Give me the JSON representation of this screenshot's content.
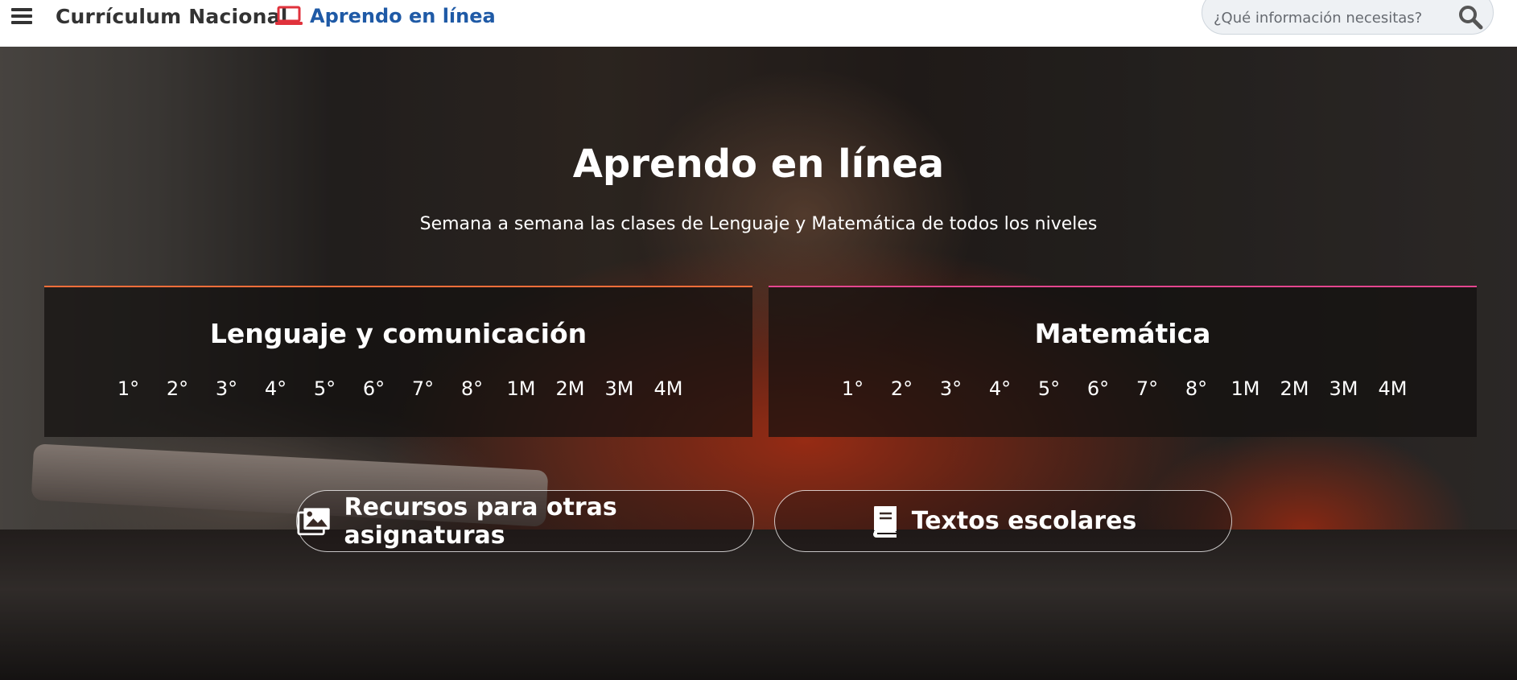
{
  "header": {
    "menu_icon": "hamburger-menu-icon",
    "brand": "Currículum Nacional",
    "aprendo_link": {
      "icon": "laptop-icon",
      "label": "Aprendo en línea",
      "color": "#1f5aa6"
    },
    "search": {
      "placeholder": "¿Qué información necesitas?",
      "value": "",
      "icon": "search-icon"
    }
  },
  "hero": {
    "title": "Aprendo en línea",
    "subtitle": "Semana a semana las clases de Lenguaje y Matemática de todos los niveles",
    "panels": [
      {
        "title": "Lenguaje y comunicación",
        "accent": "#ff6e3a",
        "grades": [
          "1°",
          "2°",
          "3°",
          "4°",
          "5°",
          "6°",
          "7°",
          "8°",
          "1M",
          "2M",
          "3M",
          "4M"
        ]
      },
      {
        "title": "Matemática",
        "accent": "#e4468f",
        "grades": [
          "1°",
          "2°",
          "3°",
          "4°",
          "5°",
          "6°",
          "7°",
          "8°",
          "1M",
          "2M",
          "3M",
          "4M"
        ]
      }
    ],
    "buttons": [
      {
        "label": "Recursos para otras asignaturas",
        "icon": "images-icon"
      },
      {
        "label": "Textos escolares",
        "icon": "book-icon"
      }
    ]
  }
}
